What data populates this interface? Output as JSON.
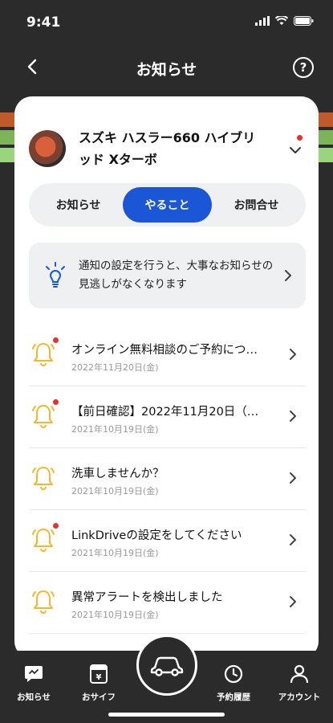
{
  "status": {
    "time": "9:41"
  },
  "nav": {
    "title": "お知らせ",
    "help": "?"
  },
  "colors": {
    "accent": "#1a56d6",
    "bell": "#f2b632",
    "unread": "#e23333",
    "dark": "#2b2b2b"
  },
  "vehicle": {
    "name": "スズキ ハスラー660 ハイブリッド Xターボ"
  },
  "tabs": [
    {
      "label": "お知らせ"
    },
    {
      "label": "やること",
      "active": true
    },
    {
      "label": "お問合せ"
    }
  ],
  "notice": {
    "text": "通知の設定を行うと、大事なお知らせの見逃しがなくなります"
  },
  "items": [
    {
      "title": "オンライン無料相談のご予約につ…",
      "date": "2022年11月20日(金)",
      "unread": true
    },
    {
      "title": "【前日確認】2022年11月20日（…",
      "date": "2021年10月19日(金)",
      "unread": true
    },
    {
      "title": "洗車しませんか？",
      "date": "2021年10月19日(金)",
      "unread": false
    },
    {
      "title": "LinkDriveの設定をしてください",
      "date": "2021年10月19日(金)",
      "unread": true
    },
    {
      "title": "異常アラートを検出しました",
      "date": "2021年10月19日(金)",
      "unread": false
    }
  ],
  "bottom_nav": [
    {
      "label": "お知らせ",
      "icon": "chat-icon"
    },
    {
      "label": "おサイフ",
      "icon": "wallet-icon"
    },
    {
      "label": "",
      "icon": "car-icon"
    },
    {
      "label": "予約履歴",
      "icon": "clock-icon"
    },
    {
      "label": "アカウント",
      "icon": "person-icon"
    }
  ]
}
